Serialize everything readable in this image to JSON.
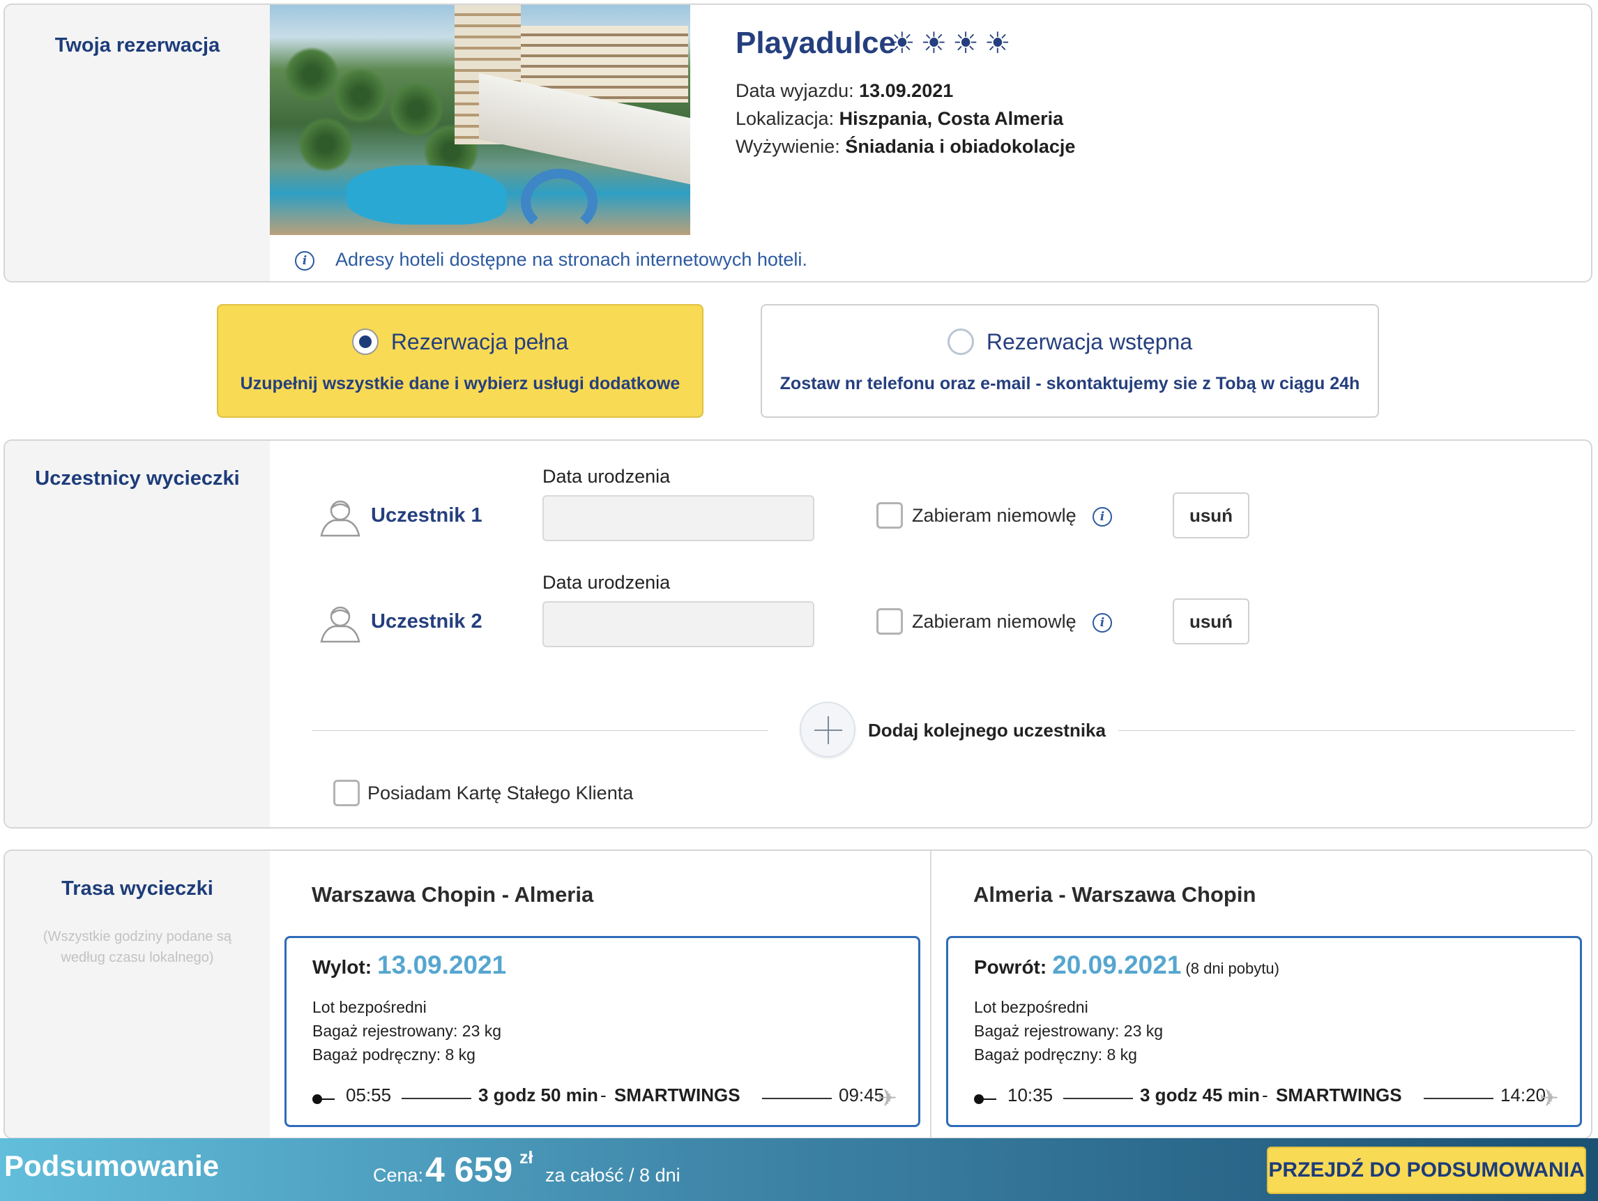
{
  "reservation": {
    "section_title": "Twoja rezerwacja",
    "hotel_name": "Playadulce",
    "hotel_rating": "☀☀☀☀",
    "departure_label": "Data wyjazdu:",
    "departure_value": "13.09.2021",
    "location_label": "Lokalizacja:",
    "location_value": "Hiszpania, Costa Almeria",
    "board_label": "Wyżywienie:",
    "board_value": "Śniadania i obiadokolacje",
    "address_note": "Adresy hoteli dostępne na stronach internetowych hoteli."
  },
  "reservation_type": {
    "full": {
      "label": "Rezerwacja pełna",
      "description": "Uzupełnij wszystkie dane i wybierz usługi dodatkowe",
      "selected": true
    },
    "preliminary": {
      "label": "Rezerwacja wstępna",
      "description": "Zostaw nr telefonu oraz e-mail - skontaktujemy sie z Tobą w ciągu 24h",
      "selected": false
    }
  },
  "participants": {
    "section_title": "Uczestnicy wycieczki",
    "items": [
      {
        "name": "Uczestnik 1",
        "birth_date_label": "Data urodzenia",
        "birth_date_value": "",
        "infant_label": "Zabieram niemowlę",
        "infant_checked": false,
        "remove_label": "usuń"
      },
      {
        "name": "Uczestnik 2",
        "birth_date_label": "Data urodzenia",
        "birth_date_value": "",
        "infant_label": "Zabieram niemowlę",
        "infant_checked": false,
        "remove_label": "usuń"
      }
    ],
    "add_label": "Dodaj kolejnego uczestnika",
    "loyalty_label": "Posiadam Kartę Stałego Klienta",
    "loyalty_checked": false
  },
  "route": {
    "section_title": "Trasa wycieczki",
    "note": "(Wszystkie godziny podane są według czasu lokalnego)",
    "legs": [
      {
        "title": "Warszawa Chopin - Almeria",
        "kind_label": "Wylot:",
        "date": "13.09.2021",
        "stay_note": "",
        "flight_type": "Lot bezpośredni",
        "checked_baggage": "Bagaż rejestrowany: 23 kg",
        "hand_baggage": "Bagaż podręczny: 8 kg",
        "dep_time": "05:55",
        "duration": "3 godz 50 min",
        "separator": "-",
        "carrier": "SMARTWINGS",
        "arr_time": "09:45"
      },
      {
        "title": "Almeria - Warszawa Chopin",
        "kind_label": "Powrót:",
        "date": "20.09.2021",
        "stay_note": "(8 dni pobytu)",
        "flight_type": "Lot bezpośredni",
        "checked_baggage": "Bagaż rejestrowany: 23 kg",
        "hand_baggage": "Bagaż podręczny: 8 kg",
        "dep_time": "10:35",
        "duration": "3 godz 45 min",
        "separator": "-",
        "carrier": "SMARTWINGS",
        "arr_time": "14:20"
      }
    ]
  },
  "summary": {
    "title": "Podsumowanie",
    "price_label": "Cena:",
    "price_value": "4 659",
    "currency": "zł",
    "price_note": "za całość / 8 dni",
    "button_label": "PRZEJDŹ DO PODSUMOWANIA"
  },
  "colors": {
    "brand_navy": "#253f7e",
    "accent_yellow": "#f8da55",
    "date_blue": "#56a6cf",
    "flight_box_border": "#2f6bb8"
  }
}
